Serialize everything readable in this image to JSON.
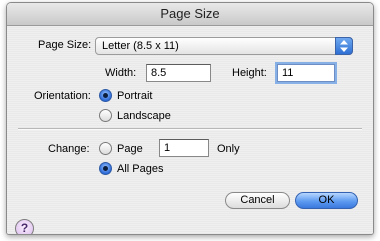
{
  "window": {
    "title": "Page Size"
  },
  "page_size": {
    "label": "Page Size:",
    "selected": "Letter (8.5 x 11)"
  },
  "width": {
    "label": "Width:",
    "value": "8.5"
  },
  "height": {
    "label": "Height:",
    "value": "11"
  },
  "orientation": {
    "label": "Orientation:",
    "portrait": "Portrait",
    "landscape": "Landscape",
    "selected": "Portrait"
  },
  "change": {
    "label": "Change:",
    "page": "Page",
    "page_number": "1",
    "only": "Only",
    "all_pages": "All Pages",
    "selected": "All Pages"
  },
  "buttons": {
    "cancel": "Cancel",
    "ok": "OK",
    "help": "?"
  },
  "icons": {
    "popup_arrows": "up-down-arrows-icon",
    "help": "help-icon"
  }
}
